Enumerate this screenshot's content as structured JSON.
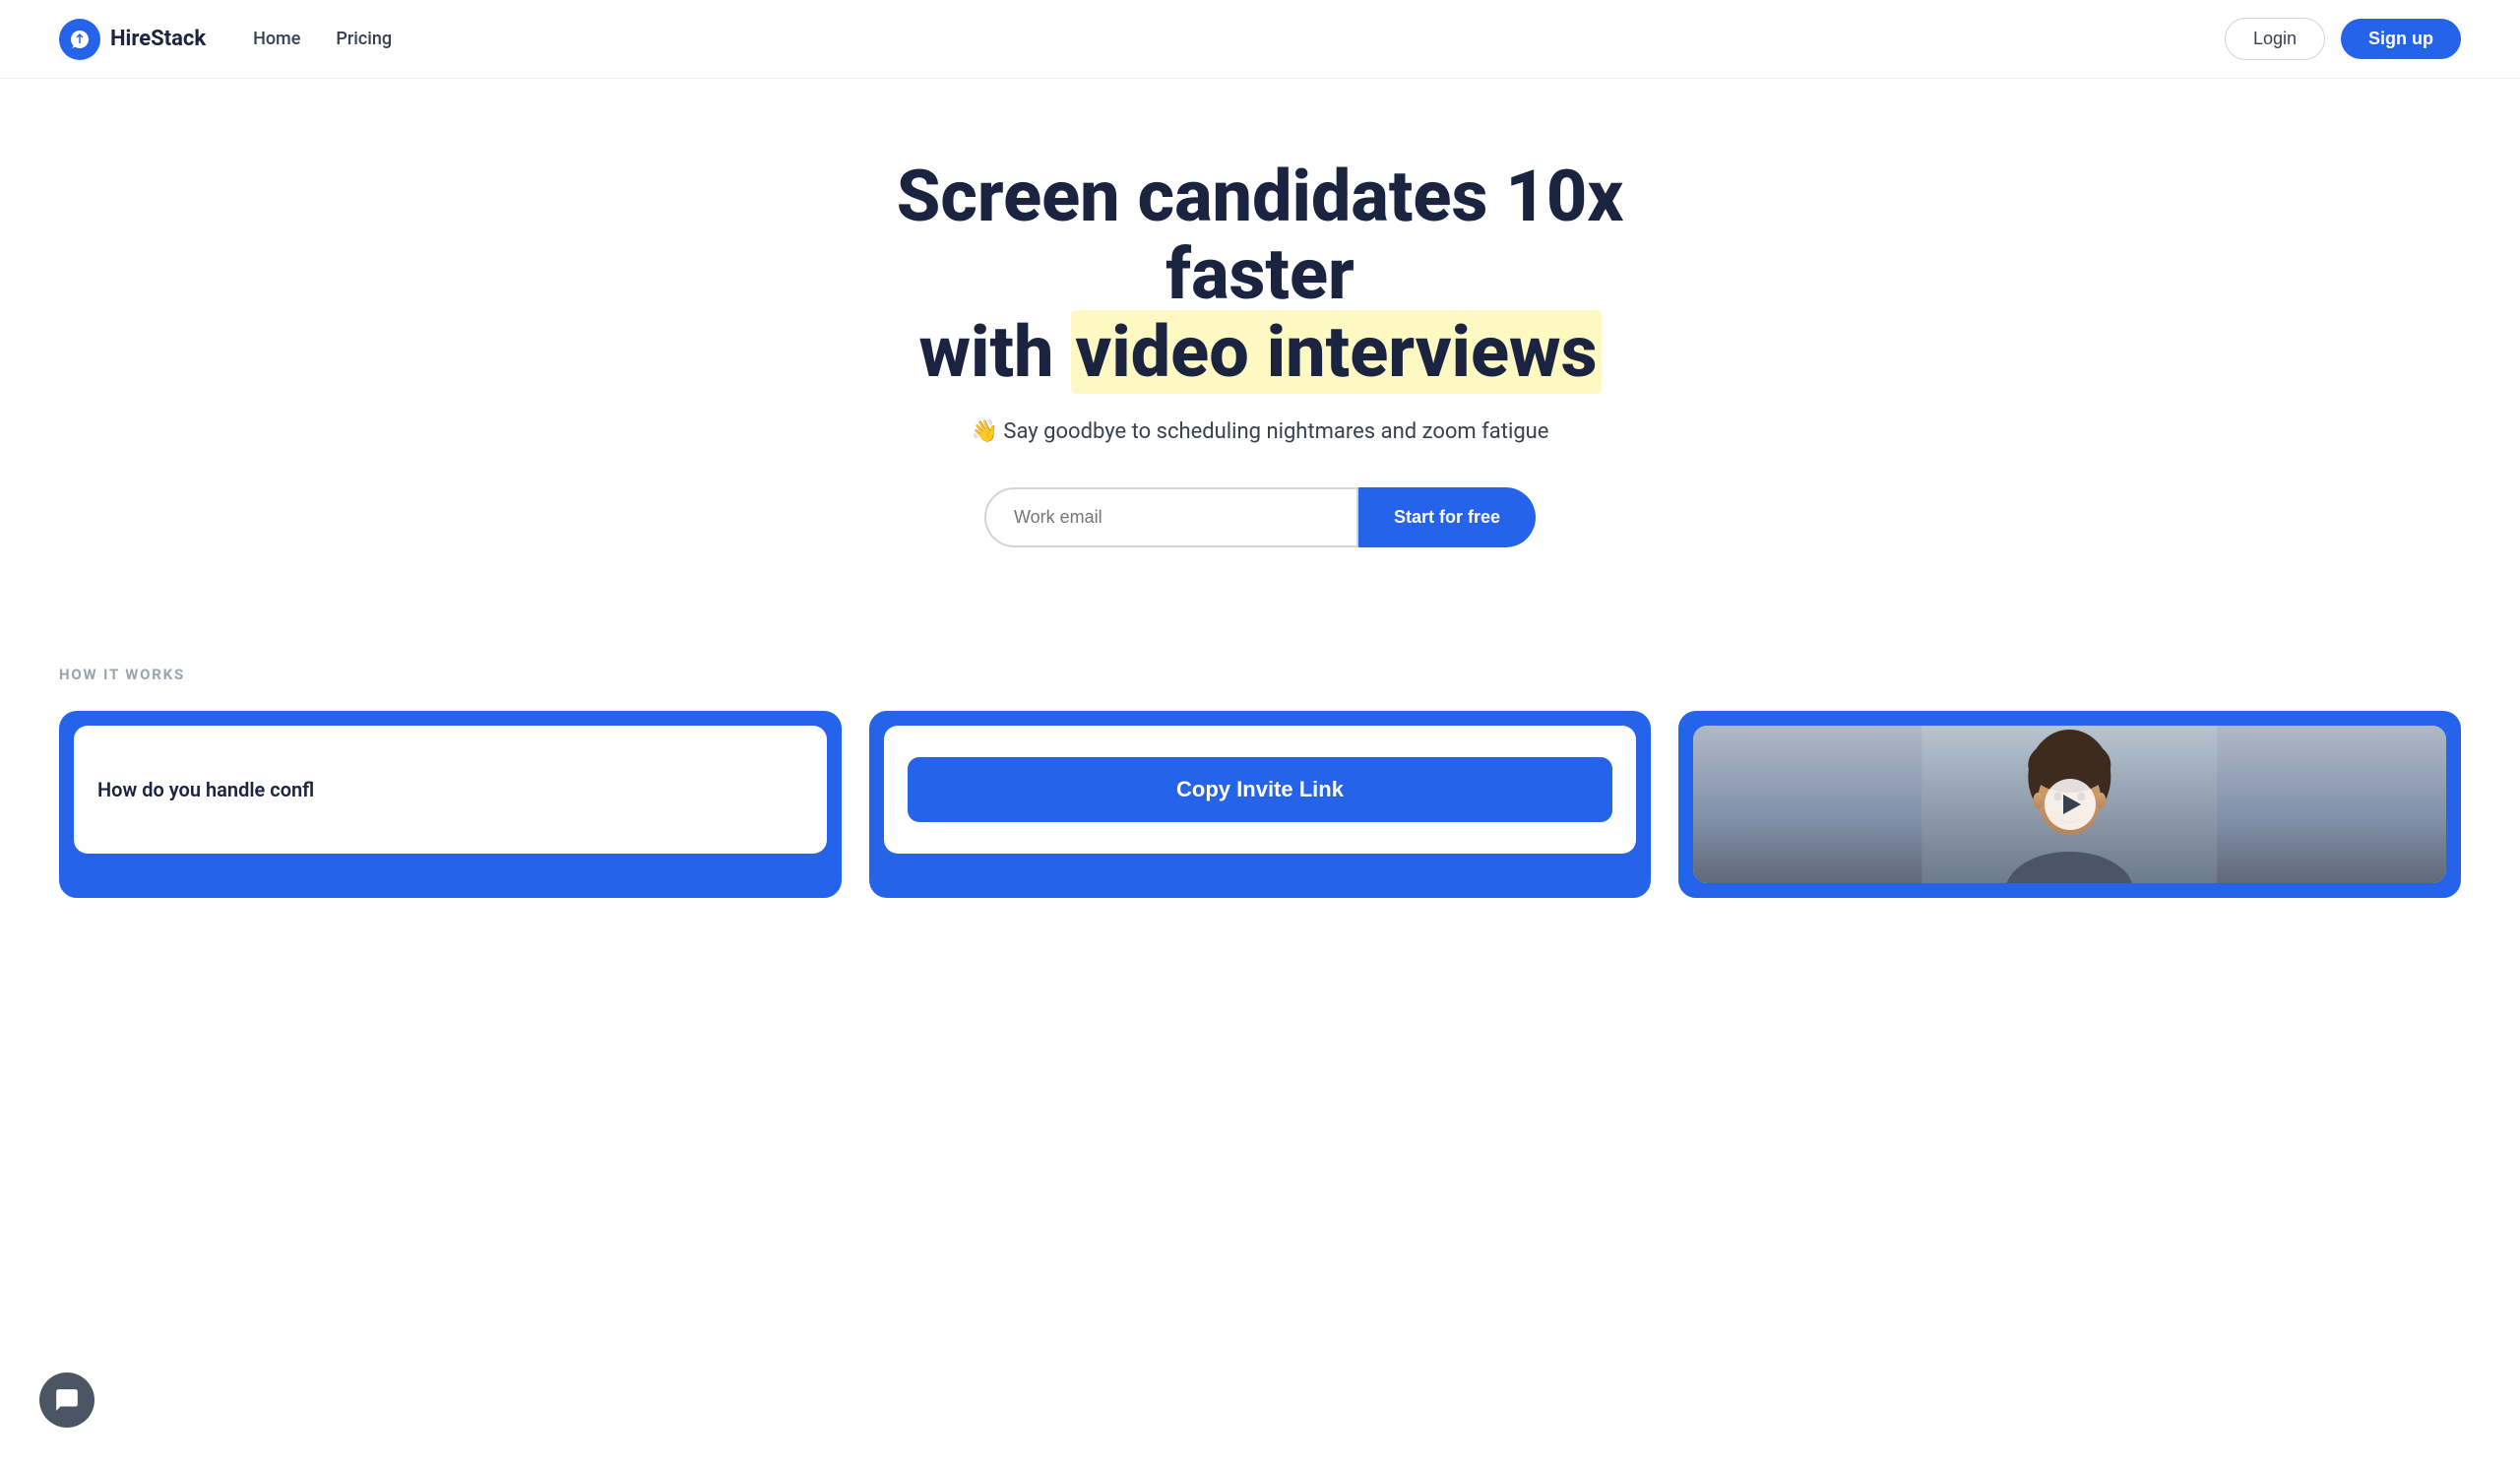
{
  "nav": {
    "logo_text": "HireStack",
    "links": [
      {
        "id": "home",
        "label": "Home"
      },
      {
        "id": "pricing",
        "label": "Pricing"
      }
    ],
    "login_label": "Login",
    "signup_label": "Sign up"
  },
  "hero": {
    "title_part1": "Screen candidates 10x faster",
    "title_part2": "with ",
    "title_highlight": "video interviews",
    "subtitle_emoji": "👋",
    "subtitle_text": "Say goodbye to scheduling nightmares and zoom fatigue",
    "email_placeholder": "Work email",
    "cta_label": "Start for free"
  },
  "how_it_works": {
    "section_label": "HOW IT WORKS",
    "cards": [
      {
        "id": "card-question",
        "text": "How do you handle confl"
      },
      {
        "id": "card-invite",
        "cta": "Copy Invite Link"
      },
      {
        "id": "card-video",
        "play_label": "Play"
      }
    ]
  },
  "chat": {
    "icon": "chat-icon"
  }
}
